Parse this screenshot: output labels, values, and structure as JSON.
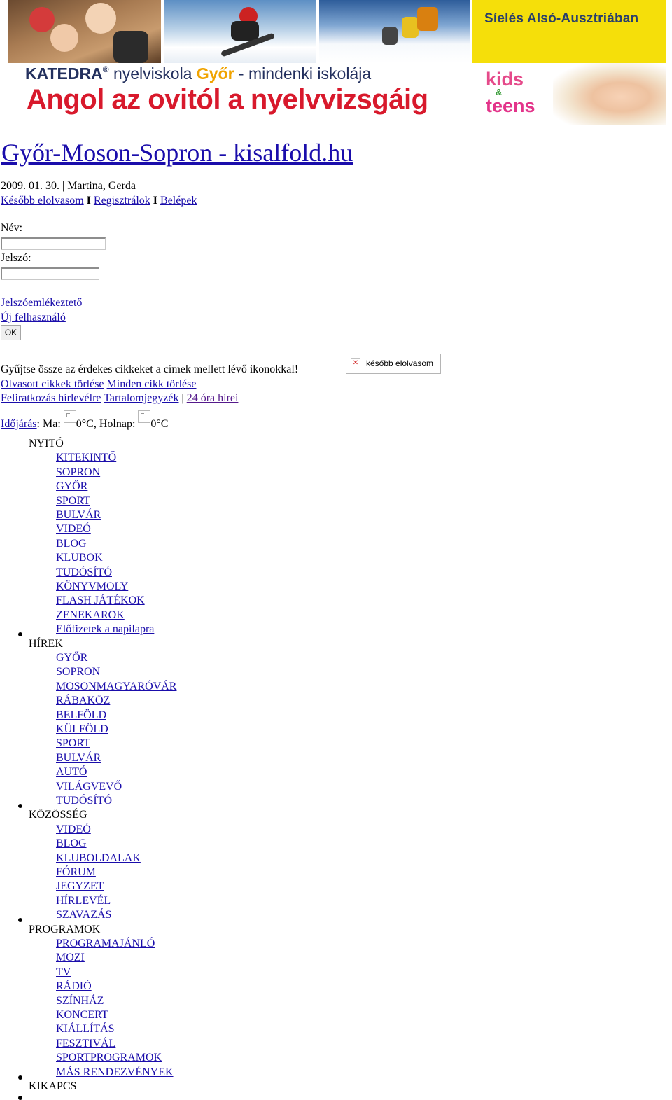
{
  "banner": {
    "slogan_top": "Síelés Alsó-Ausztriában",
    "brand": "KATEDRA",
    "brand_registered": "®",
    "brand_sub": " nyelviskola ",
    "brand_city": "Győr",
    "brand_tail": " - mindenki iskolája",
    "slogan_main": "Angol az ovitól a nyelvvizsgáig",
    "kids_line1": "kids",
    "kids_amp": "&",
    "kids_line2": "teens"
  },
  "site_title": "Győr-Moson-Sopron - kisalfold.hu",
  "date": "2009. 01. 30.",
  "date_separator": "|",
  "nameday": "Martina, Gerda",
  "account_links": {
    "read_later": "Később elolvasom",
    "separator": "I",
    "register": "Regisztrálok",
    "login": "Belépek"
  },
  "login_form": {
    "name_label": "Név:",
    "name_value": "",
    "password_label": "Jelszó:",
    "password_value": "",
    "forgot_link": "Jelszóemlékeztető",
    "new_user_link": "Új felhasználó",
    "ok_button": "OK"
  },
  "collect_text": "Gyűjtse össze az érdekes cikkeket a címek mellett lévő ikonokkal!",
  "later_box_label": "később elolvasom",
  "clear_links": {
    "read_delete": "Olvasott cikkek törlése",
    "all_delete": "Minden cikk törlése"
  },
  "sub_links": {
    "newsletter": "Feliratkozás hírlevélre",
    "toc": "Tartalomjegyzék",
    "separator": "|",
    "news24": "24 óra hírei"
  },
  "weather": {
    "link": "Időjárás",
    "colon": ":",
    "today_label": "Ma:",
    "today_value": "0°C,",
    "tomorrow_label": "Holnap:",
    "tomorrow_value": "0°C"
  },
  "nav": [
    {
      "title": "NYITÓ",
      "items": [
        "KITEKINTŐ",
        "SOPRON",
        "GYŐR",
        "SPORT",
        "BULVÁR",
        "VIDEÓ",
        "BLOG",
        "KLUBOK",
        "TUDÓSÍTÓ",
        "KÖNYVMOLY",
        "FLASH JÁTÉKOK",
        "ZENEKAROK",
        "Előfizetek a napilapra"
      ]
    },
    {
      "title": "HÍREK",
      "items": [
        "GYŐR",
        "SOPRON",
        "MOSONMAGYARÓVÁR",
        "RÁBAKÖZ",
        "BELFÖLD",
        "KÜLFÖLD",
        "SPORT",
        "BULVÁR",
        "AUTÓ",
        "VILÁGVEVŐ",
        "TUDÓSÍTÓ"
      ]
    },
    {
      "title": "KÖZÖSSÉG",
      "items": [
        "VIDEÓ",
        "BLOG",
        "KLUBOLDALAK",
        "FÓRUM",
        "JEGYZET",
        "HÍRLEVÉL",
        "SZAVAZÁS"
      ]
    },
    {
      "title": "PROGRAMOK",
      "items": [
        "PROGRAMAJÁNLÓ",
        "MOZI",
        "TV",
        "RÁDIÓ",
        "SZÍNHÁZ",
        "KONCERT",
        "KIÁLLÍTÁS",
        "FESZTIVÁL",
        "SPORTPROGRAMOK",
        "MÁS RENDEZVÉNYEK"
      ]
    },
    {
      "title": "KIKAPCS",
      "items": []
    }
  ]
}
